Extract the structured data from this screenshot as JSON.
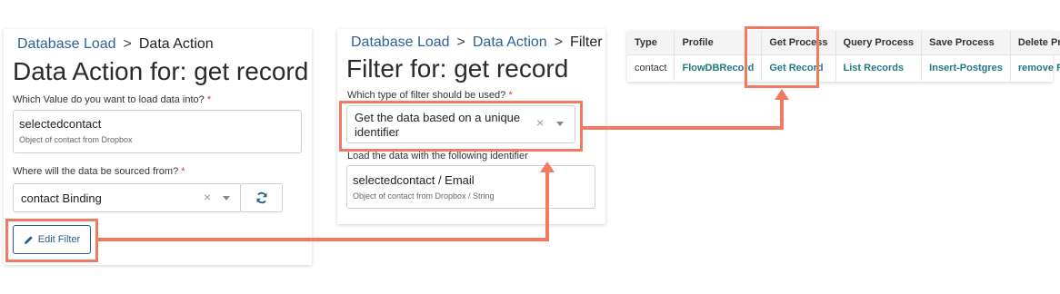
{
  "data_action": {
    "breadcrumb": {
      "link": "Database Load",
      "separator": ">",
      "current": "Data Action"
    },
    "title": "Data Action for: get record",
    "load_label": "Which Value do you want to load data into?",
    "required_mark": "*",
    "load_value": "selectedcontact",
    "load_desc": "Object of contact from Dropbox",
    "source_label": "Where will the data be sourced from?",
    "source_value": "contact Binding",
    "clear_glyph": "×",
    "refresh_icon": "refresh-icon",
    "edit_filter_label": "Edit Filter",
    "edit_icon": "pencil-icon"
  },
  "filter": {
    "breadcrumb": {
      "link1": "Database Load",
      "link2": "Data Action",
      "separator": ">",
      "current": "Filter"
    },
    "title": "Filter for: get record",
    "type_label": "Which type of filter should be used?",
    "required_mark": "*",
    "type_value_line1": "Get the data based on a unique",
    "type_value_line2": "identifier",
    "clear_glyph": "×",
    "id_label": "Load the data with the following identifier",
    "id_value": "selectedcontact / Email",
    "id_desc": "Object of contact from Dropbox / String"
  },
  "service_table": {
    "headers": [
      "Type",
      "Profile",
      "Get Process",
      "Query Process",
      "Save Process",
      "Delete Process"
    ],
    "row": [
      "contact",
      "FlowDBRecord",
      "Get Record",
      "List Records",
      "Insert-Postgres",
      "remove Record"
    ]
  },
  "colors": {
    "highlight": "#f07a62",
    "link": "#2e6296",
    "table_link": "#1f7a84",
    "button": "#2b5e86"
  }
}
